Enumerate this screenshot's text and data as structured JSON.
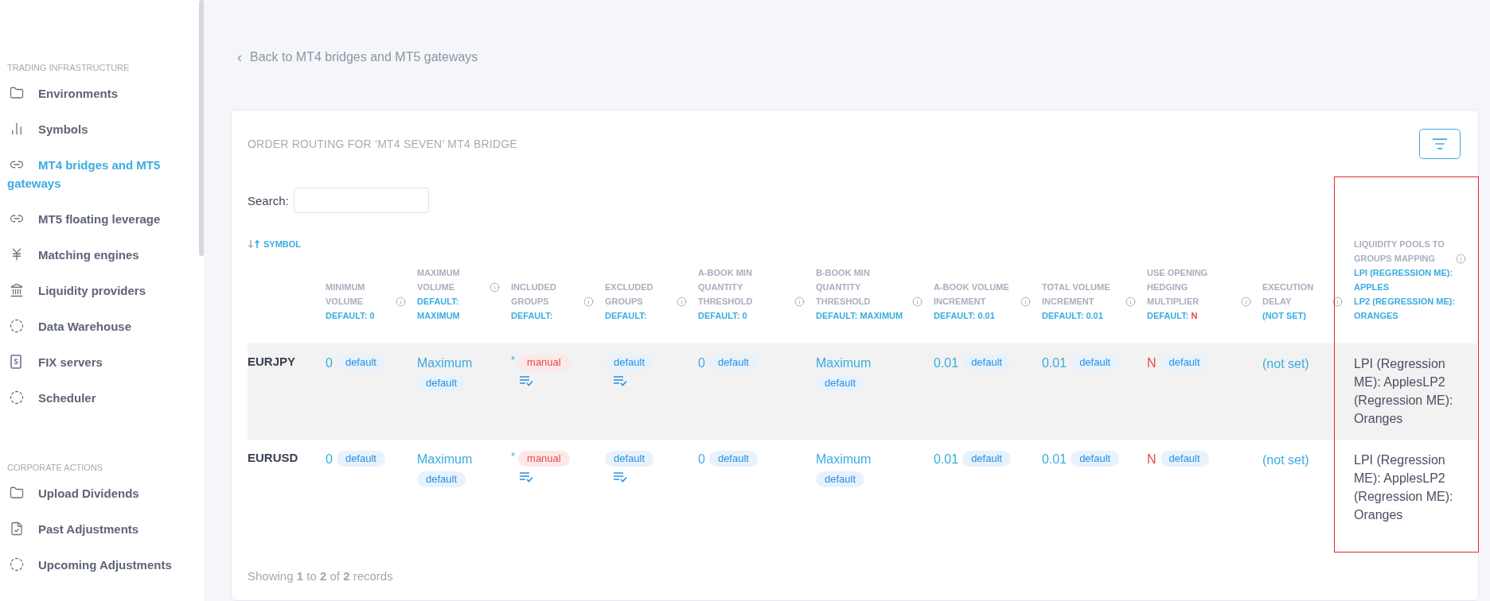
{
  "sidebar": {
    "sections": [
      {
        "title": "TRADING INFRASTRUCTURE",
        "items": [
          {
            "label": "Environments",
            "selected": false
          },
          {
            "label": "Symbols",
            "selected": false
          },
          {
            "label": "MT4 bridges and MT5 gateways",
            "selected": true
          },
          {
            "label": "MT5 floating leverage",
            "selected": false
          },
          {
            "label": "Matching engines",
            "selected": false
          },
          {
            "label": "Liquidity providers",
            "selected": false
          },
          {
            "label": "Data Warehouse",
            "selected": false
          },
          {
            "label": "FIX servers",
            "selected": false
          },
          {
            "label": "Scheduler",
            "selected": false
          }
        ]
      },
      {
        "title": "CORPORATE ACTIONS",
        "items": [
          {
            "label": "Upload Dividends",
            "selected": false
          },
          {
            "label": "Past Adjustments",
            "selected": false
          },
          {
            "label": "Upcoming Adjustments",
            "selected": false
          }
        ]
      }
    ]
  },
  "back_link": {
    "icon": "‹",
    "label": "Back to MT4 bridges and MT5 gateways"
  },
  "card": {
    "title": "ORDER ROUTING FOR ‘MT4 SEVEN’ MT4 BRIDGE",
    "search": {
      "label": "Search:"
    },
    "table": {
      "columns": [
        {
          "kind": "symbol",
          "label": "SYMBOL",
          "sort_ascending": true
        },
        {
          "kind": "field",
          "label": "MINIMUM VOLUME",
          "info": true,
          "defaults": [
            "DEFAULT: 0"
          ]
        },
        {
          "kind": "field",
          "label": "MAXIMUM VOLUME",
          "info": true,
          "defaults": [
            "DEFAULT:",
            "MAXIMUM"
          ]
        },
        {
          "kind": "field",
          "label": "INCLUDED GROUPS",
          "info": true,
          "defaults": [
            "DEFAULT:"
          ]
        },
        {
          "kind": "field",
          "label": "EXCLUDED GROUPS",
          "info": true,
          "defaults": [
            "DEFAULT:"
          ]
        },
        {
          "kind": "field",
          "label": "A-BOOK MIN QUANTITY THRESHOLD",
          "info": true,
          "defaults": [
            "DEFAULT: 0"
          ]
        },
        {
          "kind": "field",
          "label": "B-BOOK MIN QUANTITY THRESHOLD",
          "info": true,
          "defaults": [
            "DEFAULT: MAXIMUM"
          ]
        },
        {
          "kind": "field",
          "label": "A-BOOK VOLUME INCREMENT",
          "info": true,
          "defaults": [
            "DEFAULT: 0.01"
          ]
        },
        {
          "kind": "field",
          "label": "TOTAL VOLUME INCREMENT",
          "info": true,
          "defaults": [
            "DEFAULT: 0.01"
          ]
        },
        {
          "kind": "field",
          "label": "USE OPENING HEDGING MULTIPLIER",
          "info": true,
          "defaults": [
            "DEFAULT:"
          ],
          "default_flag": "N"
        },
        {
          "kind": "field",
          "label": "EXECUTION DELAY",
          "info": true,
          "defaults": [
            "(NOT SET)"
          ]
        },
        {
          "kind": "field",
          "label": "LIQUIDITY POOLS TO GROUPS MAPPING",
          "info": true,
          "defaults": [
            "LPI (REGRESSION ME): APPLES",
            "LP2 (REGRESSION ME): ORANGES"
          ],
          "highlighted": true
        }
      ],
      "rows": [
        {
          "highlighted": true,
          "cells": [
            {
              "kind": "symbol",
              "value": "EURJPY"
            },
            {
              "kind": "value",
              "value": "0",
              "alert": false,
              "badge": "default",
              "manual": false,
              "stacked": false
            },
            {
              "kind": "value",
              "value": "Maximum",
              "alert": false,
              "badge": "default",
              "manual": false,
              "stacked": true
            },
            {
              "kind": "groups",
              "prefix": "*",
              "badge": "manual",
              "manual": true
            },
            {
              "kind": "groups",
              "badge": "default",
              "manual": false
            },
            {
              "kind": "value",
              "value": "0",
              "alert": false,
              "badge": "default",
              "manual": false,
              "stacked": false
            },
            {
              "kind": "value",
              "value": "Maximum",
              "alert": false,
              "badge": "default",
              "manual": false,
              "stacked": true
            },
            {
              "kind": "value",
              "value": "0.01",
              "alert": false,
              "badge": "default",
              "manual": false,
              "stacked": false
            },
            {
              "kind": "value",
              "value": "0.01",
              "alert": false,
              "badge": "default",
              "manual": false,
              "stacked": false
            },
            {
              "kind": "value",
              "value": "N",
              "alert": true,
              "badge": "default",
              "manual": false,
              "stacked": false
            },
            {
              "kind": "link",
              "value": "(not set)"
            },
            {
              "kind": "plain",
              "value": "LPI (Regression ME): ApplesLP2 (Regression ME): Oranges"
            }
          ]
        },
        {
          "highlighted": false,
          "cells": [
            {
              "kind": "symbol",
              "value": "EURUSD"
            },
            {
              "kind": "value",
              "value": "0",
              "alert": false,
              "badge": "default",
              "manual": false,
              "stacked": false
            },
            {
              "kind": "value",
              "value": "Maximum",
              "alert": false,
              "badge": "default",
              "manual": false,
              "stacked": true
            },
            {
              "kind": "groups",
              "prefix": "*",
              "badge": "manual",
              "manual": true
            },
            {
              "kind": "groups",
              "badge": "default",
              "manual": false
            },
            {
              "kind": "value",
              "value": "0",
              "alert": false,
              "badge": "default",
              "manual": false,
              "stacked": false
            },
            {
              "kind": "value",
              "value": "Maximum",
              "alert": false,
              "badge": "default",
              "manual": false,
              "stacked": true
            },
            {
              "kind": "value",
              "value": "0.01",
              "alert": false,
              "badge": "default",
              "manual": false,
              "stacked": false
            },
            {
              "kind": "value",
              "value": "0.01",
              "alert": false,
              "badge": "default",
              "manual": false,
              "stacked": false
            },
            {
              "kind": "value",
              "value": "N",
              "alert": true,
              "badge": "default",
              "manual": false,
              "stacked": false
            },
            {
              "kind": "link",
              "value": "(not set)"
            },
            {
              "kind": "plain",
              "value": "LPI (Regression ME): ApplesLP2 (Regression ME): Oranges"
            }
          ]
        }
      ]
    },
    "footer": "Showing **1** to **2** of **2** records"
  }
}
